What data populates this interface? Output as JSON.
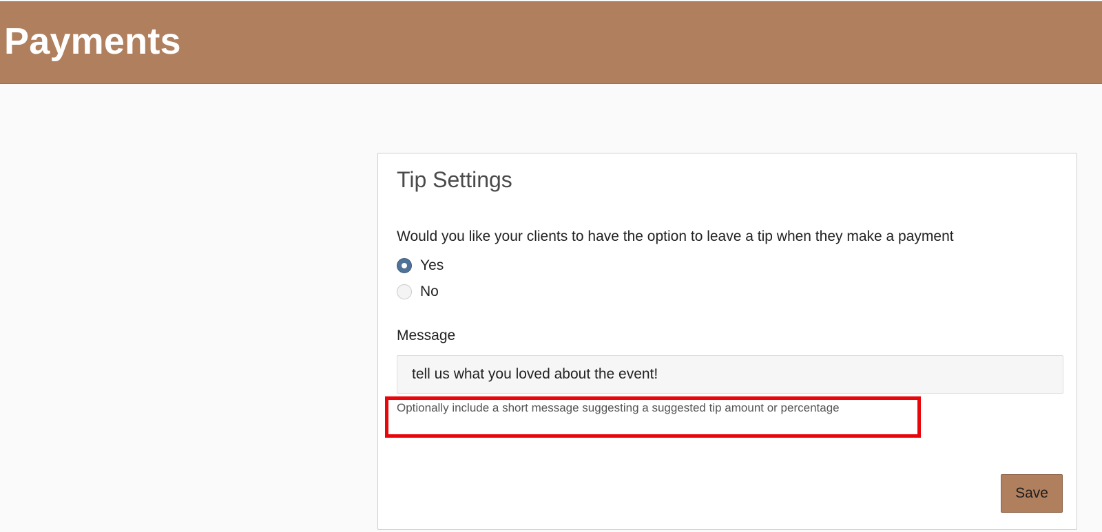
{
  "header": {
    "title": "Payments",
    "background_color": "#b07f5e"
  },
  "tip_settings": {
    "title": "Tip Settings",
    "question": "Would you like your clients to have the option to leave a tip when they make a payment",
    "options": [
      {
        "label": "Yes",
        "selected": true
      },
      {
        "label": "No",
        "selected": false
      }
    ],
    "message_label": "Message",
    "message_value": "tell us what you loved about the event!",
    "message_hint": "Optionally include a short message suggesting a suggested tip amount or percentage",
    "highlight_color": "#e8060c",
    "save_label": "Save"
  }
}
